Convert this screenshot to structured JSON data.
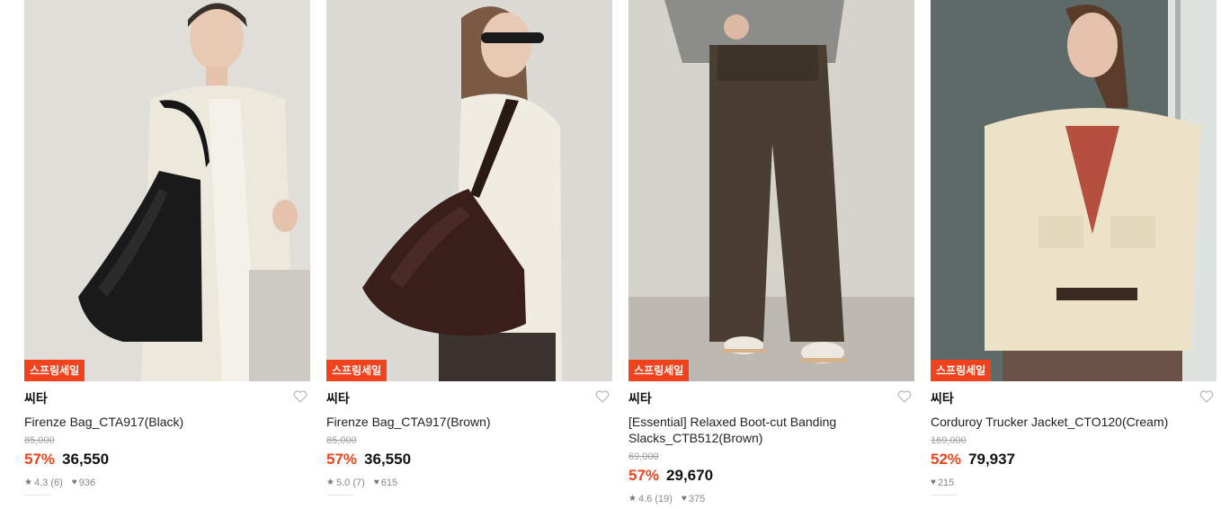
{
  "products": [
    {
      "badge": "스프링세일",
      "brand": "씨타",
      "name": "Firenze Bag_CTA917(Black)",
      "original_price": "85,000",
      "discount": "57%",
      "price": "36,550",
      "rating": "4.3",
      "reviews": "(6)",
      "likes": "936",
      "image": "woman-with-black-leather-shoulder-bag"
    },
    {
      "badge": "스프링세일",
      "brand": "씨타",
      "name": "Firenze Bag_CTA917(Brown)",
      "original_price": "85,000",
      "discount": "57%",
      "price": "36,550",
      "rating": "5.0",
      "reviews": "(7)",
      "likes": "615",
      "image": "woman-with-brown-leather-shoulder-bag"
    },
    {
      "badge": "스프링세일",
      "brand": "씨타",
      "name": "[Essential] Relaxed Boot-cut Banding Slacks_CTB512(Brown)",
      "original_price": "69,000",
      "discount": "57%",
      "price": "29,670",
      "rating": "4.6",
      "reviews": "(19)",
      "likes": "375",
      "image": "brown-bootcut-slacks-with-sneakers"
    },
    {
      "badge": "스프링세일",
      "brand": "씨타",
      "name": "Corduroy Trucker Jacket_CTO120(Cream)",
      "original_price": "169,000",
      "discount": "52%",
      "price": "79,937",
      "likes": "215",
      "image": "woman-in-cream-corduroy-jacket"
    }
  ],
  "colors": {
    "sale_red": "#f0421d",
    "muted": "#888888"
  }
}
